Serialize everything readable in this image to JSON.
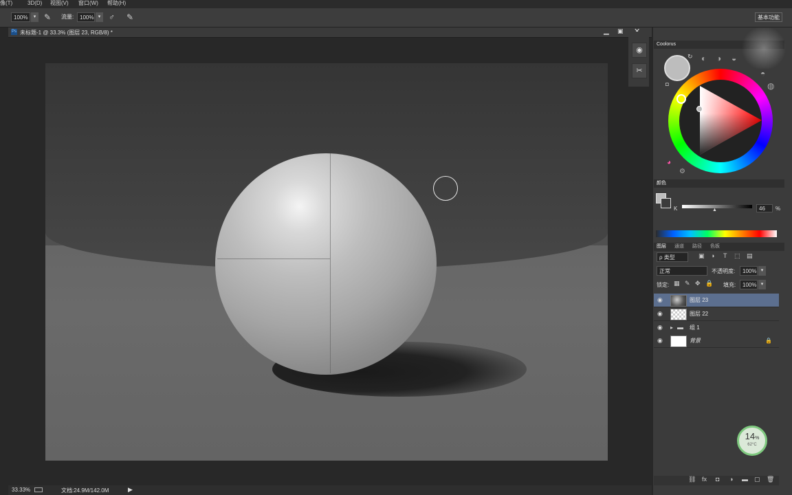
{
  "menu": [
    "像(T)",
    "3D(D)",
    "视图(V)",
    "窗口(W)",
    "帮助(H)"
  ],
  "options": {
    "size": "100%",
    "flow_label": "流量:",
    "flow": "100%",
    "workspace": "基本功能"
  },
  "document": {
    "tab_title": "未标题-1 @ 33.3% (图层 23, RGB/8) *",
    "zoom": "33.33%",
    "doc_info": "文档:24.9M/142.0M"
  },
  "panels": {
    "coolorus_title": "Coolorus",
    "color_title": "颜色",
    "k_label": "K",
    "k_value": "46",
    "k_unit": "%",
    "layer_tabs": [
      "图层",
      "通道",
      "路径",
      "色板"
    ],
    "filter_kind": "ρ 类型",
    "blend_mode": "正常",
    "opacity_label": "不透明度:",
    "opacity": "100%",
    "lock_label": "锁定:",
    "fill_label": "填充:",
    "fill": "100%"
  },
  "layers": [
    {
      "name": "图层 23",
      "selected": true
    },
    {
      "name": "图层 22",
      "selected": false
    },
    {
      "name": "组 1",
      "selected": false
    },
    {
      "name": "背景",
      "selected": false
    }
  ],
  "badge": {
    "value": "14",
    "unit": "%",
    "temp": "62°C"
  },
  "colors": {
    "selected_layer": "#5c6f8f",
    "foreground": "#bdbdbd"
  }
}
